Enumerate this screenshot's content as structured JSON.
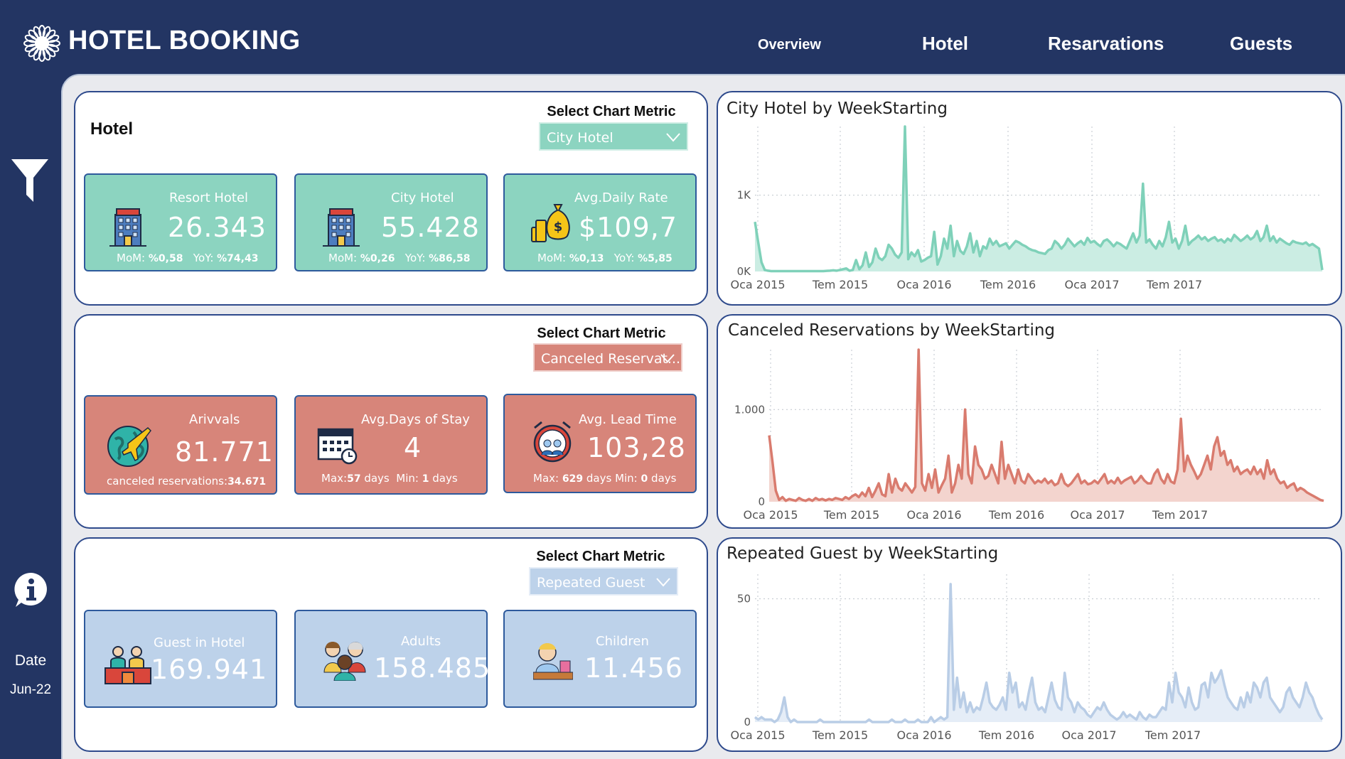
{
  "header": {
    "title": "HOTEL BOOKING",
    "nav": [
      "Overview",
      "Hotel",
      "Resarvations",
      "Guests"
    ]
  },
  "sidebar": {
    "date_label": "Date",
    "date_value": "Jun-22"
  },
  "colors": {
    "navy": "#233563",
    "teal": "#8cd4c0",
    "salmon": "#d7857a",
    "lightblue": "#bdd2ea"
  },
  "hotel_panel": {
    "title": "Hotel",
    "select_title": "Select Chart Metric",
    "select_value": "City Hotel",
    "cards": [
      {
        "label": "Resort Hotel",
        "value": "26.343",
        "mom_label": "MoM:",
        "mom": "%0,58",
        "yoy_label": "YoY:",
        "yoy": "%74,43",
        "icon": "hotel-building-icon"
      },
      {
        "label": "City Hotel",
        "value": "55.428",
        "mom_label": "MoM:",
        "mom": "%0,26",
        "yoy_label": "YoY:",
        "yoy": "%86,58",
        "icon": "hotel-building-icon"
      },
      {
        "label": "Avg.Daily Rate",
        "value": "$109,7",
        "mom_label": "MoM:",
        "mom": "%0,13",
        "yoy_label": "YoY:",
        "yoy": "%5,85",
        "icon": "money-bag-icon"
      }
    ]
  },
  "reservations_panel": {
    "select_title": "Select Chart Metric",
    "select_value": "Canceled Reservat...",
    "cards": [
      {
        "label": "Arivvals",
        "value": "81.771",
        "sub": "canceled reservations:",
        "sub_value": "34.671",
        "icon": "globe-plane-icon"
      },
      {
        "label": "Avg.Days of Stay",
        "value": "4",
        "max_label": "Max:",
        "max": "57",
        "max_unit": "days",
        "min_label": "Min:",
        "min": "1",
        "min_unit": "days",
        "icon": "calendar-clock-icon"
      },
      {
        "label": "Avg. Lead Time",
        "value": "103,28",
        "max_label": "Max:",
        "max": "629",
        "max_unit": "days",
        "min_label": "Min:",
        "min": "0",
        "min_unit": "days",
        "icon": "alarm-clock-people-icon"
      }
    ]
  },
  "guests_panel": {
    "select_title": "Select Chart Metric",
    "select_value": "Repeated Guest",
    "cards": [
      {
        "label": "Guest in Hotel",
        "value": "169.941",
        "icon": "guests-desk-icon"
      },
      {
        "label": "Adults",
        "value": "158.485",
        "icon": "adults-group-icon"
      },
      {
        "label": "Children",
        "value": "11.456",
        "icon": "child-icon"
      }
    ]
  },
  "chart_data": [
    {
      "type": "area",
      "title": "City Hotel by WeekStarting",
      "x_ticks": [
        "Oca 2015",
        "Tem 2015",
        "Oca 2016",
        "Tem 2016",
        "Oca 2017",
        "Tem 2017"
      ],
      "y_ticks": [
        {
          "value": 0,
          "label": "0K"
        },
        {
          "value": 1000,
          "label": "1K"
        }
      ],
      "ylim": [
        0,
        1900
      ],
      "color": "#7fd1b9",
      "fill": "#cbede3",
      "grid": true,
      "values": [
        650,
        380,
        120,
        20,
        10,
        5,
        5,
        5,
        5,
        5,
        5,
        5,
        5,
        5,
        5,
        5,
        5,
        5,
        5,
        5,
        5,
        5,
        8,
        10,
        15,
        10,
        20,
        30,
        40,
        10,
        20,
        150,
        30,
        80,
        250,
        60,
        120,
        300,
        180,
        150,
        200,
        350,
        300,
        220,
        180,
        250,
        1900,
        160,
        250,
        200,
        280,
        130,
        150,
        180,
        200,
        520,
        90,
        200,
        430,
        300,
        600,
        200,
        400,
        270,
        230,
        330,
        500,
        250,
        400,
        200,
        330,
        300,
        430,
        350,
        400,
        330,
        350,
        370,
        300,
        350,
        400,
        380,
        350,
        330,
        300,
        280,
        270,
        250,
        240,
        230,
        280,
        300,
        400,
        360,
        300,
        350,
        430,
        380,
        330,
        370,
        400,
        350,
        440,
        380,
        400,
        360,
        330,
        400,
        420,
        380,
        330,
        380,
        360,
        330,
        300,
        400,
        500,
        380,
        470,
        1150,
        380,
        420,
        350,
        300,
        400,
        330,
        450,
        650,
        380,
        430,
        300,
        400,
        600,
        350,
        400,
        430,
        470,
        420,
        450,
        400,
        430,
        450,
        400,
        420,
        380,
        430,
        400,
        480,
        440,
        400,
        430,
        470,
        420,
        450,
        530,
        400,
        450,
        600,
        400,
        460,
        380,
        430,
        400,
        370,
        350,
        400,
        380,
        370,
        360,
        380,
        340,
        360,
        330,
        300,
        20
      ]
    },
    {
      "type": "area",
      "title": "Canceled Reservations by WeekStarting",
      "x_ticks": [
        "Oca 2015",
        "Tem 2015",
        "Oca 2016",
        "Tem 2016",
        "Oca 2017",
        "Tem 2017"
      ],
      "y_ticks": [
        {
          "value": 0,
          "label": "0"
        },
        {
          "value": 1000,
          "label": "1.000"
        }
      ],
      "ylim": [
        0,
        1650
      ],
      "color": "#d97b6e",
      "fill": "#f3d4ce",
      "grid": true,
      "values": [
        720,
        430,
        120,
        20,
        50,
        10,
        30,
        20,
        10,
        40,
        20,
        10,
        30,
        10,
        40,
        20,
        30,
        15,
        30,
        20,
        40,
        30,
        20,
        50,
        30,
        60,
        80,
        50,
        100,
        60,
        150,
        50,
        120,
        200,
        80,
        60,
        300,
        100,
        250,
        150,
        120,
        200,
        150,
        100,
        160,
        1650,
        200,
        120,
        300,
        150,
        350,
        100,
        180,
        250,
        500,
        100,
        200,
        400,
        250,
        1000,
        300,
        200,
        600,
        400,
        350,
        250,
        280,
        400,
        300,
        200,
        650,
        250,
        400,
        300,
        200,
        350,
        230,
        200,
        300,
        250,
        200,
        230,
        210,
        250,
        200,
        230,
        180,
        200,
        300,
        200,
        170,
        200,
        250,
        300,
        200,
        230,
        190,
        200,
        230,
        200,
        250,
        300,
        200,
        230,
        200,
        260,
        200,
        230,
        250,
        270,
        200,
        230,
        280,
        230,
        200,
        200,
        300,
        350,
        250,
        200,
        300,
        220,
        200,
        350,
        900,
        330,
        500,
        400,
        330,
        250,
        300,
        400,
        500,
        350,
        600,
        700,
        500,
        550,
        400,
        450,
        330,
        380,
        300,
        330,
        350,
        300,
        380,
        300,
        350,
        250,
        450,
        300,
        350,
        250,
        200,
        220,
        150,
        180,
        200,
        120,
        150,
        130,
        100,
        80,
        60,
        40,
        20,
        10
      ]
    },
    {
      "type": "area",
      "title": "Repeated Guest by WeekStarting",
      "x_ticks": [
        "Oca 2015",
        "Tem 2015",
        "Oca 2016",
        "Tem 2016",
        "Oca 2017",
        "Tem 2017"
      ],
      "y_ticks": [
        {
          "value": 0,
          "label": "0"
        },
        {
          "value": 50,
          "label": "50"
        }
      ],
      "ylim": [
        0,
        60
      ],
      "color": "#b9cde6",
      "fill": "#e5edf7",
      "grid": true,
      "values": [
        2,
        1,
        2,
        1,
        1,
        1,
        0,
        1,
        4,
        10,
        2,
        0,
        1,
        0,
        0,
        0,
        0,
        0,
        0,
        0,
        1,
        0,
        0,
        0,
        0,
        0,
        0,
        0,
        0,
        0,
        0,
        0,
        0,
        0,
        0,
        1,
        0,
        0,
        0,
        0,
        0,
        0,
        1,
        0,
        0,
        0,
        1,
        0,
        0,
        0,
        1,
        0,
        0,
        0,
        2,
        0,
        1,
        2,
        1,
        2,
        56,
        5,
        18,
        6,
        12,
        4,
        8,
        4,
        6,
        5,
        10,
        16,
        8,
        6,
        5,
        7,
        10,
        5,
        20,
        12,
        16,
        6,
        8,
        5,
        12,
        18,
        8,
        5,
        6,
        4,
        10,
        16,
        9,
        6,
        5,
        20,
        10,
        8,
        4,
        8,
        6,
        5,
        3,
        2,
        4,
        6,
        5,
        8,
        5,
        3,
        2,
        1,
        2,
        4,
        2,
        3,
        2,
        1,
        4,
        2,
        1,
        3,
        2,
        2,
        4,
        6,
        5,
        16,
        8,
        20,
        12,
        10,
        6,
        14,
        8,
        5,
        6,
        15,
        16,
        10,
        20,
        16,
        18,
        21,
        15,
        10,
        8,
        6,
        5,
        10,
        6,
        12,
        8,
        16,
        14,
        10,
        16,
        18,
        10,
        8,
        6,
        4,
        6,
        12,
        14,
        10,
        8,
        6,
        10,
        16,
        12,
        10,
        6,
        3,
        1
      ]
    }
  ]
}
